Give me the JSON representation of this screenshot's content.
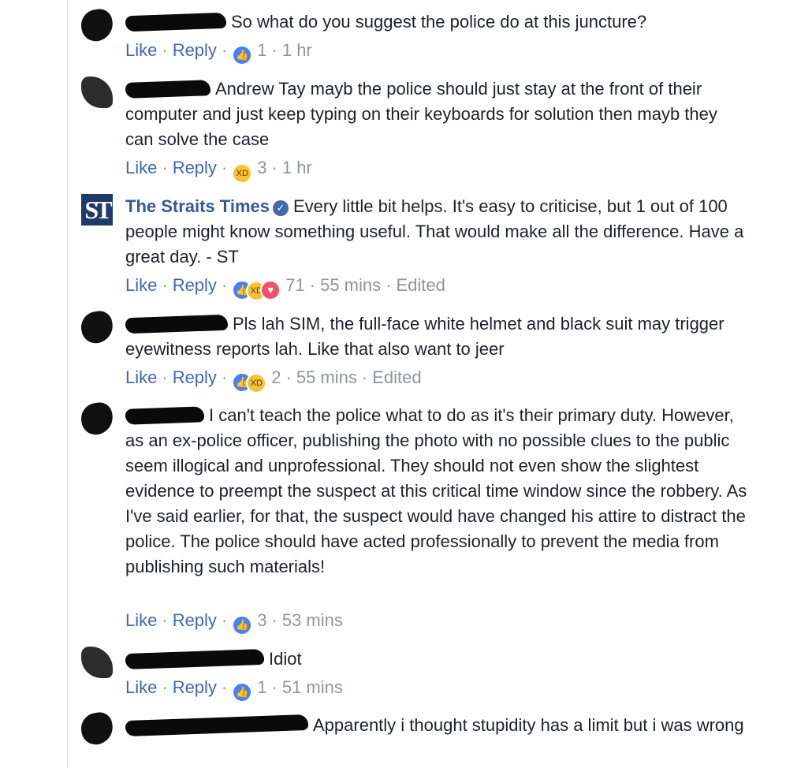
{
  "comments": [
    {
      "author": "",
      "text": "So what do you suggest the police do at this juncture?",
      "like_label": "Like",
      "reply_label": "Reply",
      "reaction_count": "1",
      "time": "1 hr",
      "edited": ""
    },
    {
      "author": "",
      "text": "Andrew Tay mayb the police should just stay at the front of their computer and just keep typing on their keyboards for solution then mayb they can solve the case",
      "like_label": "Like",
      "reply_label": "Reply",
      "reaction_count": "3",
      "time": "1 hr",
      "edited": ""
    },
    {
      "author": "The Straits Times",
      "logo_text": "ST",
      "text": "Every little bit helps. It's easy to criticise, but 1 out of 100 people might know something useful. That would make all the difference. Have a great day. - ST",
      "like_label": "Like",
      "reply_label": "Reply",
      "reaction_count": "71",
      "time": "55 mins",
      "edited": "Edited"
    },
    {
      "author": "",
      "text": "Pls lah SIM, the full-face white helmet and black suit may trigger eyewitness reports lah. Like that also want to jeer",
      "like_label": "Like",
      "reply_label": "Reply",
      "reaction_count": "2",
      "time": "55 mins",
      "edited": "Edited"
    },
    {
      "author": "",
      "text": "I can't teach the police what to do as it's their primary duty. However, as an ex-police officer, publishing the photo with no possible clues to the public seem illogical and unprofessional. They should not even show the slightest evidence to preempt the suspect at this critical time window since the robbery. As I've said earlier, for that, the suspect would have changed his attire to distract the police. The police should have acted professionally to prevent the media from publishing such materials!",
      "like_label": "Like",
      "reply_label": "Reply",
      "reaction_count": "3",
      "time": "53 mins",
      "edited": ""
    },
    {
      "author": "",
      "text": "Idiot",
      "like_label": "Like",
      "reply_label": "Reply",
      "reaction_count": "1",
      "time": "51 mins",
      "edited": ""
    },
    {
      "author": "",
      "text": "Apparently i thought stupidity has a limit but i was wrong",
      "like_label": "Like",
      "reply_label": "Reply",
      "reaction_count": "",
      "time": "",
      "edited": ""
    }
  ],
  "colors": {
    "link": "#4267b2",
    "author": "#365899",
    "meta": "#90949c",
    "like_reaction": "#4a80f5",
    "haha_reaction": "#f7c330",
    "love_reaction": "#f2506b"
  },
  "icons": [
    "thumbs-up-icon",
    "haha-icon",
    "love-icon",
    "verified-badge-icon"
  ]
}
